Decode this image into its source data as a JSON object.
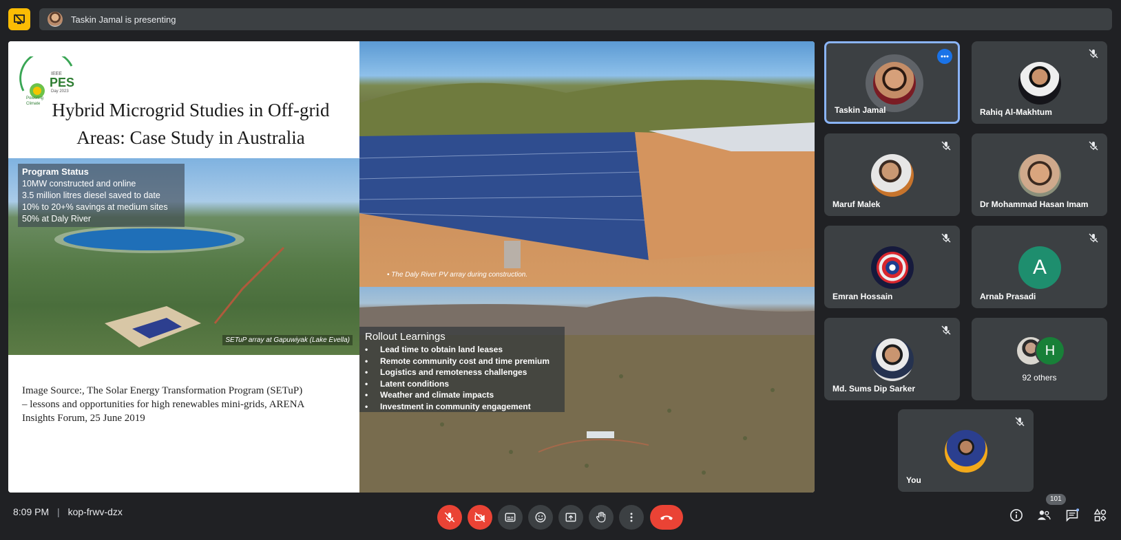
{
  "presenter_bar": {
    "text": "Taskin Jamal is presenting"
  },
  "slide": {
    "logo": {
      "line1": "IEEE",
      "line2": "PES",
      "line3": "Day 2023",
      "line4": "Powering",
      "line5": "Climate"
    },
    "title_line1": "Hybrid Microgrid Studies in Off-grid",
    "title_line2": "Areas: Case Study in Australia",
    "program_status": {
      "title": "Program Status",
      "lines": [
        "10MW constructed and online",
        "3.5 million litres diesel saved to date",
        "10% to 20+% savings at medium sites",
        "50% at Daly River"
      ]
    },
    "lake_caption": "SETuP array at Gapuwiyak (Lake Evella)",
    "solar_caption": "• The Daly River PV array during construction.",
    "rollout": {
      "title": "Rollout Learnings",
      "items": [
        "Lead time to obtain land leases",
        "Remote community cost and time premium",
        "Logistics and remoteness challenges",
        "Latent conditions",
        "Weather and climate impacts",
        "Investment in community engagement"
      ]
    },
    "source_line1": "Image Source:, The Solar Energy Transformation Program (SETuP)",
    "source_line2": "– lessons and opportunities for high renewables mini-grids, ARENA",
    "source_line3": "Insights Forum, 25 June 2019"
  },
  "participants": [
    {
      "name": "Taskin Jamal"
    },
    {
      "name": "Rahiq Al-Makhtum"
    },
    {
      "name": "Maruf Malek"
    },
    {
      "name": "Dr Mohammad Hasan Imam"
    },
    {
      "name": "Emran Hossain"
    },
    {
      "name": "Arnab Prasadi",
      "initial": "A"
    },
    {
      "name": "Md. Sums Dip Sarker"
    },
    {
      "others": "92 others",
      "initial": "H"
    },
    {
      "name": "You"
    }
  ],
  "bottom": {
    "time": "8:09 PM",
    "separator": "|",
    "meeting_code": "kop-frwv-dzx",
    "people_count": "101"
  },
  "colors": {
    "background": "#202124",
    "tile": "#3c4043",
    "accent": "#8ab4f8",
    "danger": "#ea4335",
    "presenting": "#fbbc04"
  }
}
